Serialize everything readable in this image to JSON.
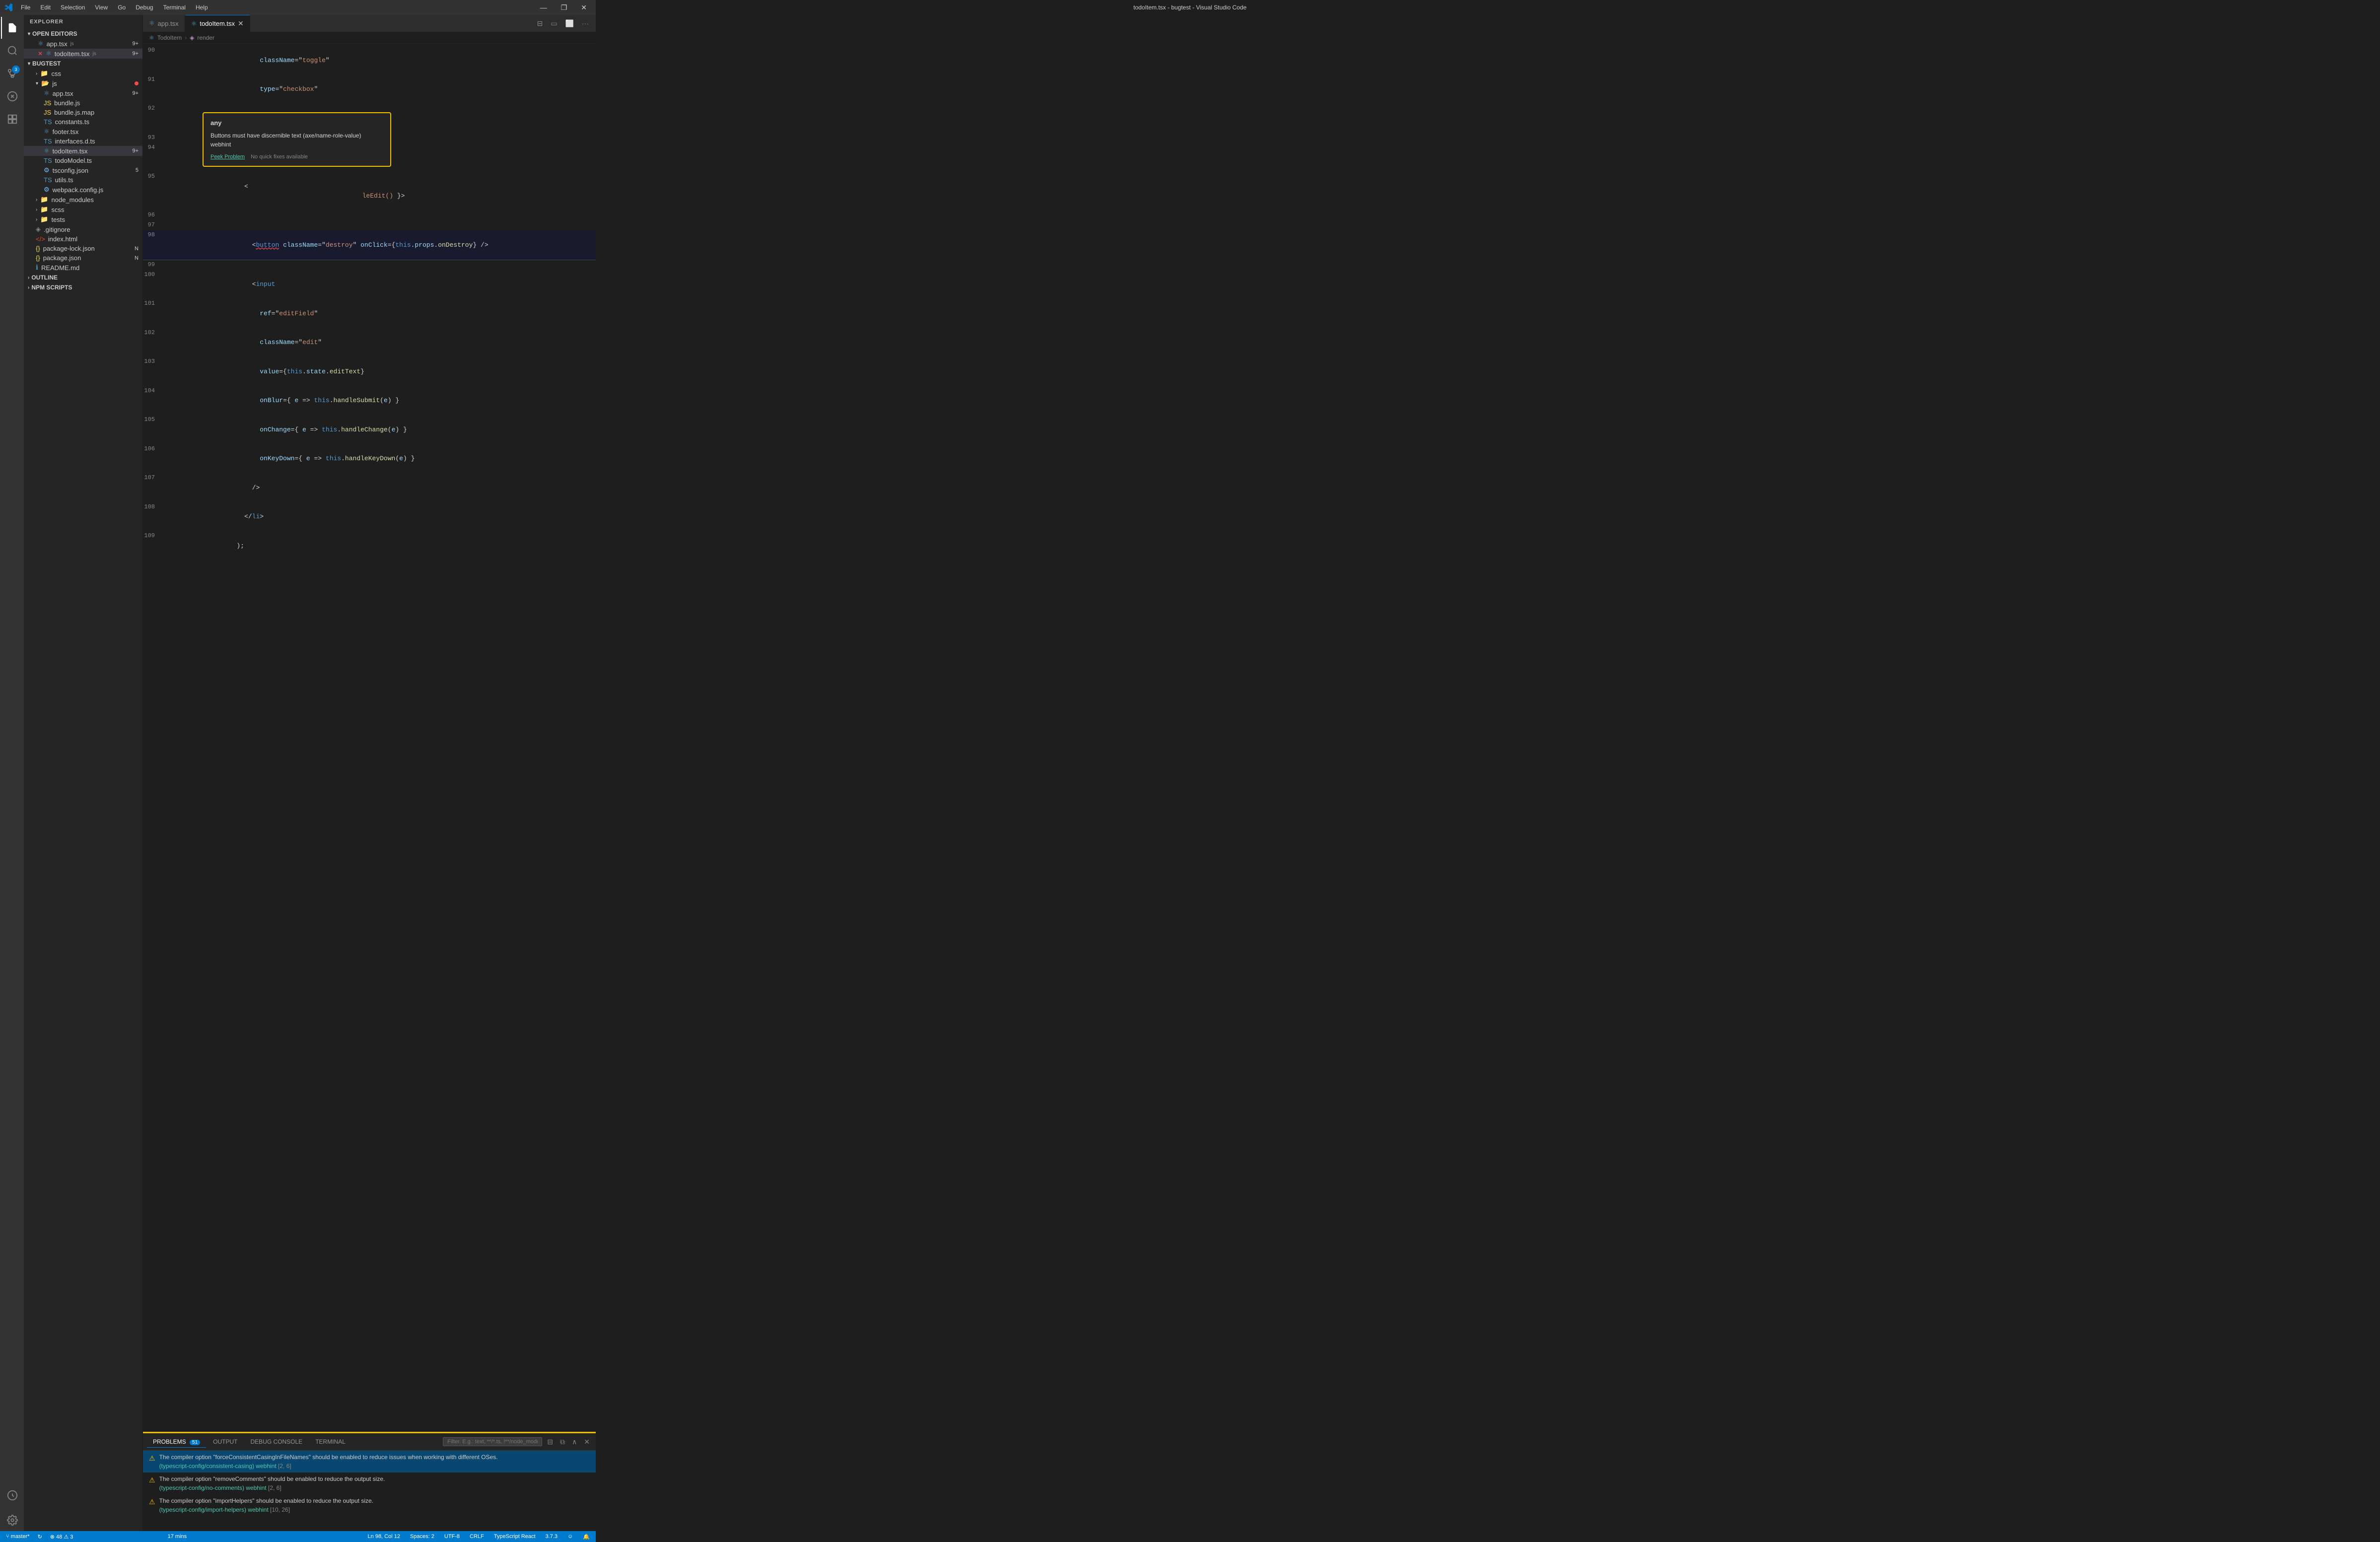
{
  "titleBar": {
    "title": "todoItem.tsx - bugtest - Visual Studio Code",
    "menuItems": [
      "File",
      "Edit",
      "Selection",
      "View",
      "Go",
      "Debug",
      "Terminal",
      "Help"
    ],
    "windowControls": [
      "—",
      "❐",
      "✕"
    ]
  },
  "activityBar": {
    "icons": [
      {
        "name": "explorer-icon",
        "symbol": "⬜",
        "label": "Explorer",
        "active": true
      },
      {
        "name": "search-icon",
        "symbol": "🔍",
        "label": "Search",
        "active": false
      },
      {
        "name": "source-control-icon",
        "symbol": "⑂",
        "label": "Source Control",
        "active": false,
        "badge": "3"
      },
      {
        "name": "debug-icon",
        "symbol": "🐛",
        "label": "Run and Debug",
        "active": false
      },
      {
        "name": "extensions-icon",
        "symbol": "⧉",
        "label": "Extensions",
        "active": false
      }
    ],
    "bottomIcons": [
      {
        "name": "remote-icon",
        "symbol": "⚙",
        "label": "Remote"
      },
      {
        "name": "settings-icon",
        "symbol": "⚙",
        "label": "Settings"
      }
    ]
  },
  "sidebar": {
    "title": "EXPLORER",
    "sections": {
      "openEditors": {
        "label": "OPEN EDITORS",
        "files": [
          {
            "name": "app.tsx",
            "type": "tsx",
            "icon": "⚛",
            "badge": "9+"
          },
          {
            "name": "todoItem.tsx",
            "type": "tsx",
            "icon": "⚛",
            "badge": "9+",
            "modified": true
          }
        ]
      },
      "bugtest": {
        "label": "BUGTEST",
        "items": [
          {
            "name": "css",
            "type": "folder",
            "indent": 1
          },
          {
            "name": "js",
            "type": "folder",
            "indent": 1,
            "dot": true
          },
          {
            "name": "app.tsx",
            "type": "tsx",
            "indent": 2,
            "badge": "9+"
          },
          {
            "name": "bundle.js",
            "type": "js",
            "indent": 2
          },
          {
            "name": "bundle.js.map",
            "type": "js",
            "indent": 2
          },
          {
            "name": "constants.ts",
            "type": "ts",
            "indent": 2
          },
          {
            "name": "footer.tsx",
            "type": "tsx",
            "indent": 2
          },
          {
            "name": "interfaces.d.ts",
            "type": "ts",
            "indent": 2
          },
          {
            "name": "todoItem.tsx",
            "type": "tsx",
            "indent": 2,
            "badge": "9+",
            "active": true
          },
          {
            "name": "todoModel.ts",
            "type": "ts",
            "indent": 2
          },
          {
            "name": "tsconfig.json",
            "type": "json",
            "indent": 2,
            "badge": "5"
          },
          {
            "name": "utils.ts",
            "type": "ts",
            "indent": 2
          },
          {
            "name": "webpack.config.js",
            "type": "js",
            "indent": 2
          },
          {
            "name": "node_modules",
            "type": "folder",
            "indent": 1
          },
          {
            "name": "scss",
            "type": "folder",
            "indent": 1
          },
          {
            "name": "tests",
            "type": "folder",
            "indent": 1
          },
          {
            "name": ".gitignore",
            "type": "file",
            "indent": 1
          },
          {
            "name": "index.html",
            "type": "html",
            "indent": 1
          },
          {
            "name": "package-lock.json",
            "type": "json",
            "indent": 1,
            "modified": "N"
          },
          {
            "name": "package.json",
            "type": "json",
            "indent": 1,
            "modified": "N"
          },
          {
            "name": "README.md",
            "type": "md",
            "indent": 1
          }
        ]
      },
      "outline": {
        "label": "OUTLINE"
      },
      "npmScripts": {
        "label": "NPM SCRIPTS"
      }
    }
  },
  "tabs": [
    {
      "label": "app.tsx",
      "icon": "⚛",
      "active": false,
      "closable": false
    },
    {
      "label": "todoItem.tsx",
      "icon": "⚛",
      "active": true,
      "closable": true
    }
  ],
  "breadcrumb": {
    "items": [
      "TodoItem",
      "render"
    ]
  },
  "codeLines": [
    {
      "num": 90,
      "content": "            className=\"toggle\""
    },
    {
      "num": 91,
      "content": "            type=\"checkbox\""
    },
    {
      "num": 92,
      "content": "          />"
    },
    {
      "num": 93,
      "content": ""
    },
    {
      "num": 94,
      "content": "        /"
    },
    {
      "num": 95,
      "content": "        <",
      "hasError": true
    },
    {
      "num": 96,
      "content": ""
    },
    {
      "num": 97,
      "content": ""
    },
    {
      "num": 98,
      "content": "          <button className=\"destroy\" onClick={this.props.onDestroy} />",
      "hasError": true
    },
    {
      "num": 99,
      "content": ""
    },
    {
      "num": 100,
      "content": "          <input"
    },
    {
      "num": 101,
      "content": "            ref=\"editField\""
    },
    {
      "num": 102,
      "content": "            className=\"edit\""
    },
    {
      "num": 103,
      "content": "            value={this.state.editText}"
    },
    {
      "num": 104,
      "content": "            onBlur={ e => this.handleSubmit(e) }"
    },
    {
      "num": 105,
      "content": "            onChange={ e => this.handleChange(e) }"
    },
    {
      "num": 106,
      "content": "            onKeyDown={ e => this.handleKeyDown(e) }"
    },
    {
      "num": 107,
      "content": "          />"
    },
    {
      "num": 108,
      "content": "        </li>"
    },
    {
      "num": 109,
      "content": "      );"
    }
  ],
  "problemPopup": {
    "type": "any",
    "message": "Buttons must have discernible text (axe/name-role-value) webhint",
    "peekLabel": "Peek Problem",
    "noFixesLabel": "No quick fixes available"
  },
  "panel": {
    "tabs": [
      {
        "label": "PROBLEMS",
        "count": "51",
        "active": true
      },
      {
        "label": "OUTPUT",
        "active": false
      },
      {
        "label": "DEBUG CONSOLE",
        "active": false
      },
      {
        "label": "TERMINAL",
        "active": false
      }
    ],
    "filterPlaceholder": "Filter. E.g.: text, **/*.ts, !**/node_modules/**",
    "problems": [
      {
        "type": "warning",
        "selected": true,
        "message": "The compiler option \"forceConsistentCasingInFileNames\" should be enabled to reduce issues when working with different OSes.",
        "source": "(typescript-config/consistent-casing) webhint",
        "location": "[2, 6]"
      },
      {
        "type": "warning",
        "selected": false,
        "message": "The compiler option \"removeComments\" should be enabled to reduce the output size.",
        "source": "(typescript-config/no-comments) webhint",
        "location": "[2, 6]"
      },
      {
        "type": "warning",
        "selected": false,
        "message": "The compiler option \"importHelpers\" should be enabled to reduce the output size.",
        "source": "(typescript-config/import-helpers) webhint",
        "location": "[10, 26]"
      }
    ]
  },
  "statusBar": {
    "left": [
      {
        "label": "⑂ master*"
      },
      {
        "label": "↻"
      },
      {
        "label": "⊗ 48  ⚠ 3"
      }
    ],
    "center": {
      "label": "17 mins"
    },
    "right": [
      {
        "label": "Ln 98, Col 12"
      },
      {
        "label": "Spaces: 2"
      },
      {
        "label": "UTF-8"
      },
      {
        "label": "CRLF"
      },
      {
        "label": "TypeScript React"
      },
      {
        "label": "3.7.3"
      },
      {
        "label": "☺"
      },
      {
        "label": "🔔"
      }
    ]
  }
}
